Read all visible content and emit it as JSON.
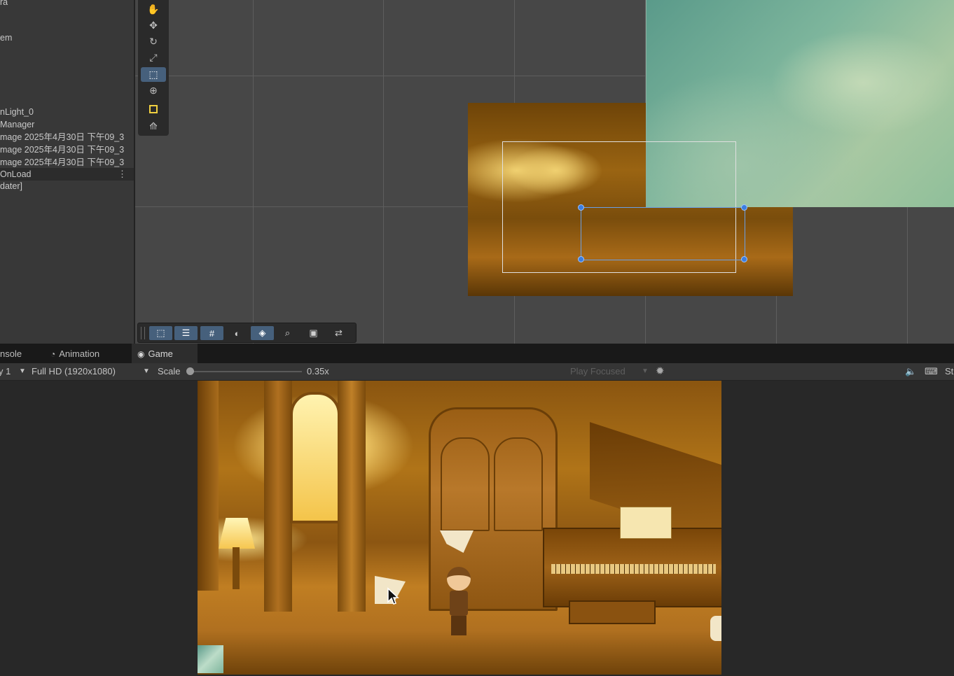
{
  "hierarchy": {
    "items": [
      {
        "label": "ra"
      },
      {
        "label": "em"
      },
      {
        "label": "nLight_0"
      },
      {
        "label": "Manager"
      },
      {
        "label": "mage 2025年4月30日 下午09_3"
      },
      {
        "label": "mage 2025年4月30日 下午09_3"
      },
      {
        "label": "mage 2025年4月30日 下午09_3"
      },
      {
        "label": "OnLoad"
      },
      {
        "label": "dater]"
      }
    ],
    "more_icon": "kebab-menu-icon"
  },
  "scene_tools": [
    "hand-tool-icon",
    "move-tool-icon",
    "rotate-tool-icon",
    "scale-tool-icon",
    "rect-tool-icon",
    "transform-tool-icon",
    "custom-tool-icon",
    "path-tool-icon"
  ],
  "scene_overlay_tools": [
    "rect-icon",
    "align-icon",
    "grid-snap-icon",
    "circle-icon",
    "layers-icon",
    "zoom-icon",
    "monitor-icon",
    "shuffle-icon"
  ],
  "tabs": {
    "console": "nsole",
    "animation": "Animation",
    "game": "Game"
  },
  "game_toolbar": {
    "display": "y 1",
    "resolution": "Full HD (1920x1080)",
    "scale_label": "Scale",
    "scale_value": "0.35x",
    "scale_fraction": 0.0,
    "play_mode": "Play Focused",
    "right_cut": "St"
  },
  "colors": {
    "accent_blue": "#46607c",
    "handle_blue": "#3c7ee0"
  }
}
